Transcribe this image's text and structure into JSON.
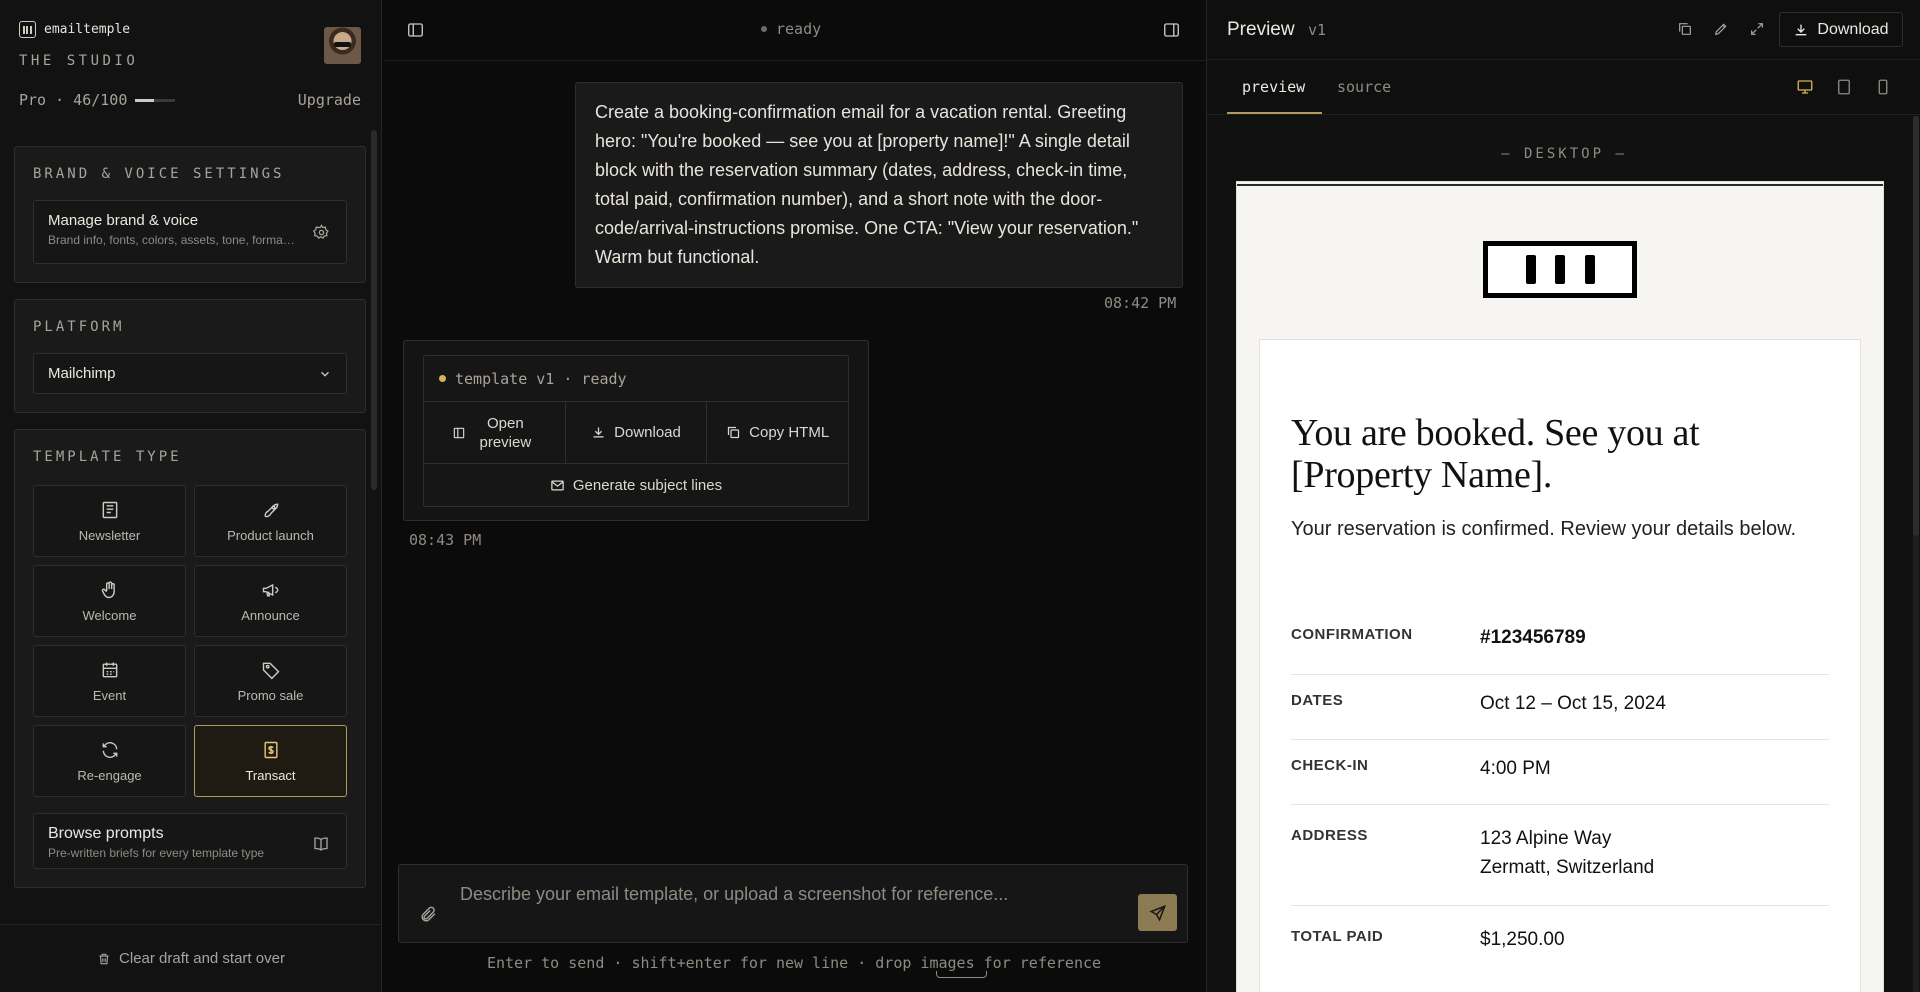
{
  "sidebar": {
    "app_name": "emailtemple",
    "studio": "THE STUDIO",
    "plan_text": "Pro · 46/100",
    "plan_usage": 0.46,
    "upgrade": "Upgrade",
    "brand_section": {
      "title": "Brand & voice settings",
      "manage_title": "Manage brand & voice",
      "manage_desc": "Brand info, fonts, colors, assets, tone, formatting"
    },
    "platform_section": {
      "title": "Platform",
      "selected": "Mailchimp"
    },
    "template_section": {
      "title": "Template type",
      "types": [
        {
          "label": "Newsletter",
          "icon": "newspaper-icon"
        },
        {
          "label": "Product launch",
          "icon": "rocket-icon"
        },
        {
          "label": "Welcome",
          "icon": "wave-hand-icon"
        },
        {
          "label": "Announce",
          "icon": "megaphone-icon"
        },
        {
          "label": "Event",
          "icon": "calendar-icon"
        },
        {
          "label": "Promo sale",
          "icon": "tag-icon"
        },
        {
          "label": "Re-engage",
          "icon": "refresh-icon"
        },
        {
          "label": "Transact",
          "icon": "receipt-icon"
        }
      ],
      "active": "Transact"
    },
    "browse": {
      "title": "Browse prompts",
      "desc": "Pre-written briefs for every template type"
    },
    "footer": "Clear draft and start over"
  },
  "chat": {
    "status": "ready",
    "user_message": "Create a booking-confirmation email for a vacation rental. Greeting hero: \"You're booked — see you at [property name]!\" A single detail block with the reservation summary (dates, address, check-in time, total paid, confirmation number), and a short note with the door-code/arrival-instructions promise. One CTA: \"View your reservation.\" Warm but functional.",
    "user_time": "08:42 PM",
    "bot": {
      "status": "template v1 · ready",
      "open_preview": "Open preview",
      "download": "Download",
      "copy_html": "Copy HTML",
      "generate": "Generate subject lines",
      "time": "08:43 PM"
    },
    "composer_placeholder": "Describe your email template, or upload a screenshot for reference...",
    "hint": "Enter to send · shift+enter for new line · drop images for reference"
  },
  "preview": {
    "title": "Preview",
    "version": "v1",
    "download": "Download",
    "tabs": [
      "preview",
      "source"
    ],
    "active_tab": "preview",
    "device_label": "— DESKTOP —",
    "email": {
      "headline": "You are booked. See you at [Property Name].",
      "subhead": "Your reservation is confirmed. Review your details below.",
      "rows": [
        {
          "label": "CONFIRMATION",
          "value": "#123456789"
        },
        {
          "label": "DATES",
          "value": "Oct 12 – Oct 15, 2024"
        },
        {
          "label": "CHECK-IN",
          "value": "4:00 PM"
        },
        {
          "label": "ADDRESS",
          "value_line1": "123 Alpine Way",
          "value_line2": "Zermatt, Switzerland"
        },
        {
          "label": "TOTAL PAID",
          "value": "$1,250.00"
        }
      ]
    }
  },
  "colors": {
    "accent": "#b09a5c",
    "status_dot": "#d6b35a",
    "send_button": "#8b7a52"
  }
}
